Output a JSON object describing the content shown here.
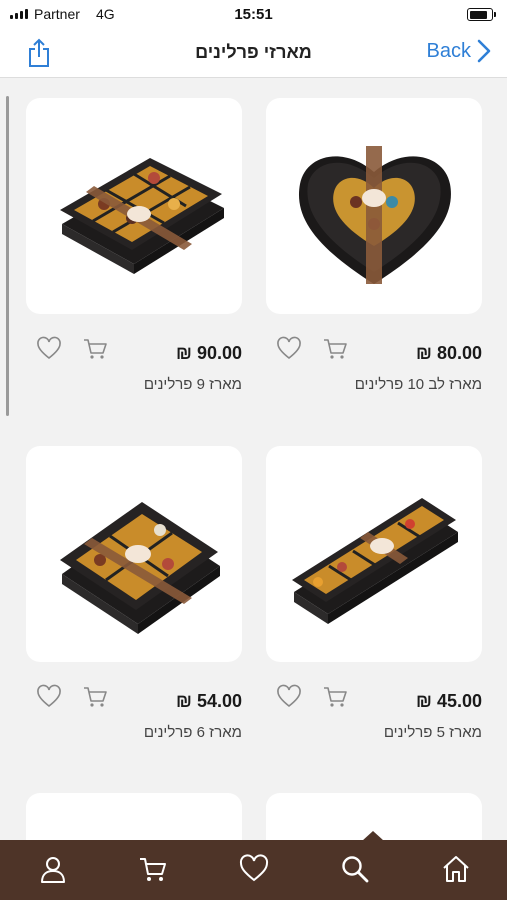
{
  "status_bar": {
    "carrier": "Partner",
    "network": "4G",
    "time": "15:51",
    "battery_level": 0.85
  },
  "nav": {
    "title": "מארזי פרלינים",
    "back_label": "Back"
  },
  "colors": {
    "accent": "#2f7fd6",
    "tab_bar": "#4e3428",
    "background": "#f2f2f2"
  },
  "products": [
    {
      "name": "מארז 9 פרלינים",
      "price": "₪ 90.00",
      "shape": "box-9"
    },
    {
      "name": "מארז לב 10 פרלינים",
      "price": "₪ 80.00",
      "shape": "heart"
    },
    {
      "name": "מארז 6 פרלינים",
      "price": "₪ 54.00",
      "shape": "box-6"
    },
    {
      "name": "מארז 5 פרלינים",
      "price": "₪ 45.00",
      "shape": "box-5"
    }
  ],
  "tabs": [
    {
      "icon": "user-icon"
    },
    {
      "icon": "cart-icon"
    },
    {
      "icon": "heart-icon"
    },
    {
      "icon": "search-icon",
      "active": true
    },
    {
      "icon": "home-icon"
    }
  ]
}
